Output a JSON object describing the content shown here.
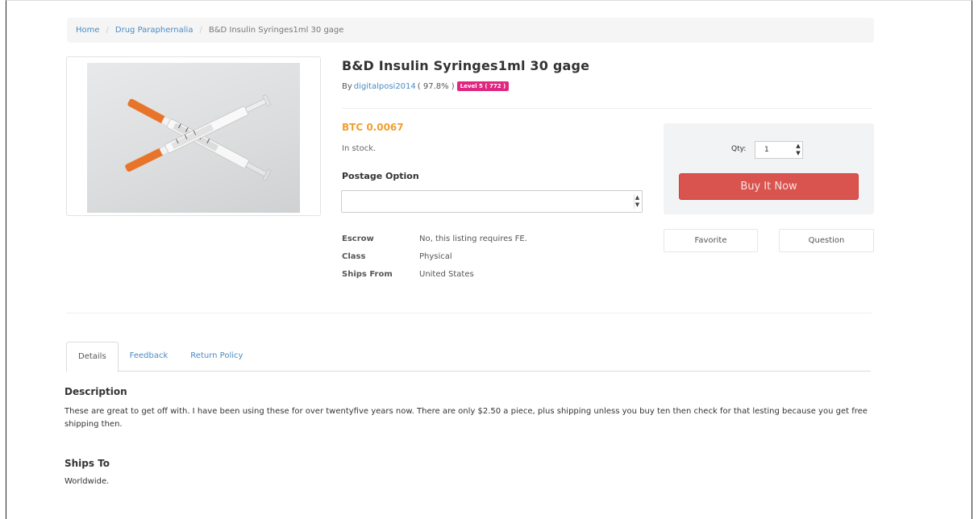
{
  "breadcrumb": {
    "home": "Home",
    "category": "Drug Paraphernalia",
    "current": "B&D Insulin Syringes1ml 30 gage"
  },
  "product": {
    "title": "B&D Insulin Syringes1ml 30 gage",
    "by_label": "By",
    "seller": "digitalposi2014",
    "rating": "( 97.8% )",
    "level_badge": "Level 5 ( 772 )",
    "price": "BTC 0.0067",
    "stock": "In stock."
  },
  "postage": {
    "label": "Postage Option",
    "selected": ""
  },
  "details": [
    {
      "key": "Escrow",
      "value": "No, this listing requires FE."
    },
    {
      "key": "Class",
      "value": "Physical"
    },
    {
      "key": "Ships From",
      "value": "United States"
    }
  ],
  "buy": {
    "qty_label": "Qty:",
    "qty_value": "1",
    "buy_label": "Buy It Now"
  },
  "actions": {
    "favorite": "Favorite",
    "question": "Question"
  },
  "tabs": [
    {
      "label": "Details"
    },
    {
      "label": "Feedback"
    },
    {
      "label": "Return Policy"
    }
  ],
  "description": {
    "title": "Description",
    "text": "These are great to get off with. I have been using these for over twentyfive years now. There are only $2.50 a piece, plus shipping unless you buy ten then check for that lesting because you get free shipping then."
  },
  "ships_to": {
    "title": "Ships To",
    "text": "Worldwide."
  },
  "colors": {
    "link": "#4a8bc2",
    "price": "#f0a030",
    "buy_button": "#d9534f",
    "badge": "#e0267f",
    "syringe_cap": "#e8742a"
  },
  "icons": {
    "product_image": "syringes-photo",
    "select_arrow": "spinner-arrows"
  }
}
